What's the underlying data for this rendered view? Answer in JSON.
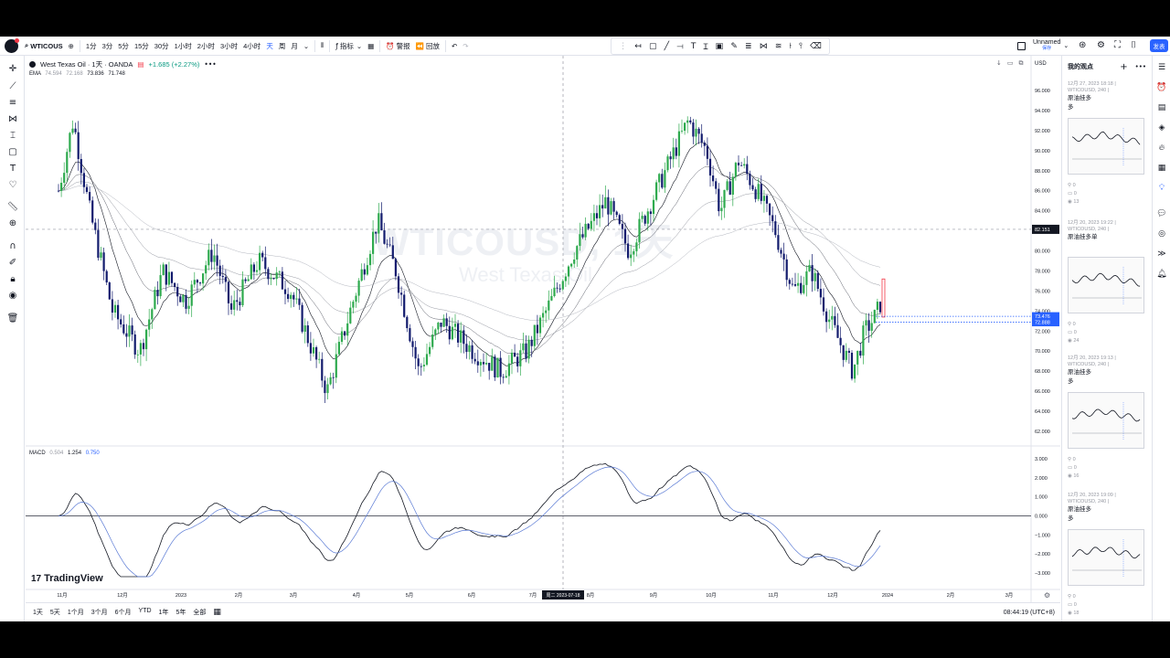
{
  "topbar": {
    "symbol": "WTICOUS",
    "intervals": [
      "1分",
      "3分",
      "5分",
      "15分",
      "30分",
      "1小时",
      "2小时",
      "3小时",
      "4小时",
      "天",
      "周",
      "月"
    ],
    "active_interval": "天",
    "indicators_label": "指标",
    "alert_label": "警报",
    "replay_label": "回放",
    "layout_name": "Unnamed",
    "layout_status": "保存",
    "publish_label": "发表"
  },
  "legend": {
    "title": "West Texas Oil · 1天 · OANDA",
    "change": "+1.685 (+2.27%)",
    "ema_label": "EMA",
    "ema_values": [
      "74.594",
      "72.168",
      "73.836",
      "71.748"
    ]
  },
  "macd": {
    "label": "MACD",
    "values": [
      "0.504",
      "1.254",
      "0.750"
    ],
    "y_labels": [
      "3.000",
      "2.000",
      "1.000",
      "0.000",
      "−1.000",
      "−2.000",
      "−3.000"
    ]
  },
  "watermark": {
    "symbol": "WTICOUSD, 1天",
    "name": "West Texas Oil"
  },
  "price_axis": {
    "currency": "USD",
    "labels": [
      "96.000",
      "94.000",
      "92.000",
      "90.000",
      "88.000",
      "86.000",
      "84.000",
      "82.000",
      "80.000",
      "78.000",
      "76.000",
      "74.000",
      "72.000",
      "70.000",
      "68.000",
      "66.000",
      "64.000",
      "62.000"
    ],
    "crosshair_price": "82.151",
    "last_price_1": "73.476",
    "last_price_2": "72.888"
  },
  "time_axis": {
    "labels": [
      "11月",
      "12月",
      "2023",
      "2月",
      "3月",
      "4月",
      "5月",
      "6月",
      "7月",
      "8月",
      "9月",
      "10月",
      "11月",
      "12月",
      "2024",
      "2月",
      "3月"
    ],
    "crosshair_date": "周二 2023-07-18"
  },
  "bottom": {
    "ranges": [
      "1天",
      "5天",
      "1个月",
      "3个月",
      "6个月",
      "YTD",
      "1年",
      "5年",
      "全部"
    ],
    "clock": "08:44:19 (UTC+8)"
  },
  "brand": "TradingView",
  "ideas_panel": {
    "title": "我的观点",
    "ideas": [
      {
        "date": "12月 27, 2023 18:18 |",
        "symbol": "WTICOUSD, 240 |",
        "title": "原油挂多",
        "side": "多",
        "stats": [
          "0",
          "0",
          "13"
        ]
      },
      {
        "date": "12月 20, 2023 19:22 |",
        "symbol": "WTICOUSD, 240 |",
        "title": "原油挂多单",
        "side": "",
        "stats": [
          "0",
          "0",
          "24"
        ]
      },
      {
        "date": "12月 20, 2023 19:13 |",
        "symbol": "WTICOUSD, 240 |",
        "title": "原油挂多",
        "side": "多",
        "stats": [
          "0",
          "0",
          "16"
        ]
      },
      {
        "date": "12月 20, 2023 19:09 |",
        "symbol": "WTICOUSD, 240 |",
        "title": "原油挂多",
        "side": "多",
        "stats": [
          "0",
          "0",
          "18"
        ]
      }
    ]
  },
  "colors": {
    "up": "#2eaa4e",
    "down": "#131c6e",
    "accent": "#2962ff"
  }
}
